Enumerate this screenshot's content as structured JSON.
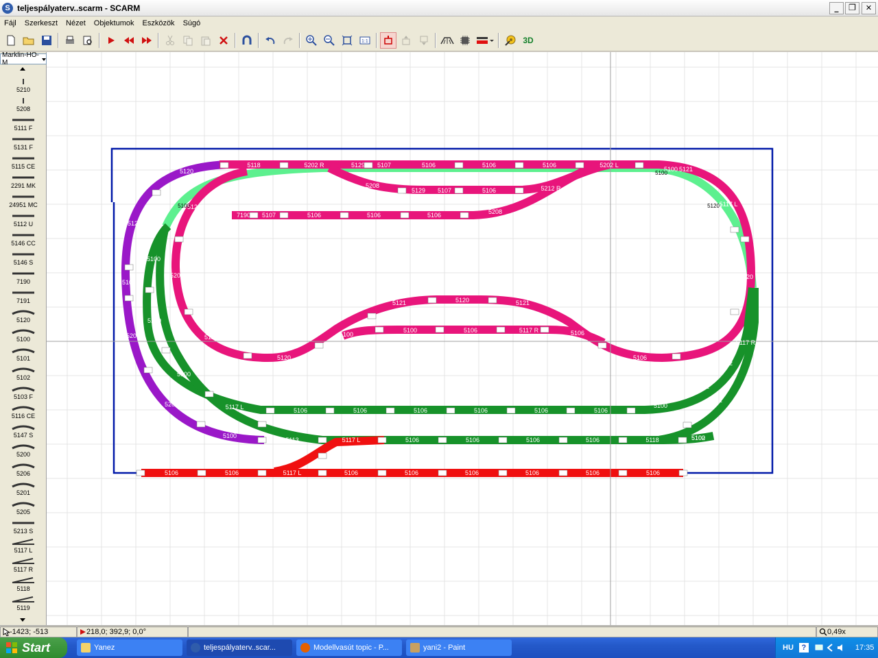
{
  "window": {
    "title": "teljespályaterv..scarm - SCARM",
    "app_icon": "S",
    "minimize_label": "_",
    "restore_label": "❐",
    "close_label": "✕"
  },
  "menu": [
    "Fájl",
    "Szerkeszt",
    "Nézet",
    "Objektumok",
    "Eszközök",
    "Súgó"
  ],
  "toolbar": {
    "buttons": [
      {
        "icon": "new-file-icon",
        "enabled": true
      },
      {
        "icon": "open-folder-icon",
        "enabled": true
      },
      {
        "icon": "save-icon",
        "enabled": true
      },
      {
        "icon": "print-icon",
        "enabled": true
      },
      {
        "icon": "print-preview-icon",
        "enabled": true
      },
      {
        "icon": "play-icon",
        "enabled": true
      },
      {
        "icon": "rewind-icon",
        "enabled": true
      },
      {
        "icon": "forward-icon",
        "enabled": true
      },
      {
        "icon": "cut-icon",
        "enabled": false
      },
      {
        "icon": "copy-icon",
        "enabled": false
      },
      {
        "icon": "paste-icon",
        "enabled": false
      },
      {
        "icon": "delete-icon",
        "enabled": true
      },
      {
        "icon": "magnet-icon",
        "enabled": true
      },
      {
        "icon": "undo-icon",
        "enabled": true
      },
      {
        "icon": "redo-icon",
        "enabled": false
      },
      {
        "icon": "zoom-in-icon",
        "enabled": true
      },
      {
        "icon": "zoom-out-icon",
        "enabled": true
      },
      {
        "icon": "zoom-fit-icon",
        "enabled": true
      },
      {
        "icon": "zoom-1to1-icon",
        "enabled": true
      },
      {
        "icon": "layer-icon",
        "enabled": true
      },
      {
        "icon": "layer-up-icon",
        "enabled": false
      },
      {
        "icon": "layer-down-icon",
        "enabled": false
      },
      {
        "icon": "bridge-icon",
        "enabled": true
      },
      {
        "icon": "chip-icon",
        "enabled": true
      },
      {
        "icon": "line-color-icon",
        "enabled": true
      },
      {
        "icon": "measure-icon",
        "enabled": true
      },
      {
        "icon": "3d-view-icon",
        "label": "3D",
        "enabled": true
      }
    ]
  },
  "library": {
    "selected": "Marklin-HO-M",
    "items": [
      "5210",
      "5208",
      "5111 F",
      "5131 F",
      "5115 CE",
      "2291 MK",
      "24951 MC",
      "5112 U",
      "5146 CC",
      "5146 S",
      "7190",
      "7191",
      "5120",
      "5100",
      "5101",
      "5102",
      "5103 F",
      "5116 CE",
      "5147 S",
      "5200",
      "5206",
      "5201",
      "5205",
      "5213 S",
      "5117 L",
      "5117 R",
      "5118",
      "5119"
    ]
  },
  "colors": {
    "magenta": "#e8157b",
    "purple": "#9a18c8",
    "dark_green": "#17922a",
    "light_green": "#5df08f",
    "red": "#f01010",
    "board": "#0018a8"
  },
  "track_labels": {
    "magenta": [
      "5120",
      "5118",
      "5202 R",
      "5129",
      "5107",
      "5106",
      "5106",
      "5106",
      "5202 L",
      "5100",
      "5208",
      "5129",
      "5107",
      "5106",
      "5212 R",
      "5208",
      "5121",
      "7190",
      "5107",
      "5106",
      "5106",
      "5106",
      "5206",
      "5120",
      "5120",
      "5121",
      "5120",
      "5121",
      "5100",
      "5106",
      "5100",
      "5117 R",
      "5106",
      "5106",
      "5107",
      "5117 L",
      "5120",
      "5121",
      "5120"
    ],
    "purple": [
      "5120",
      "5107",
      "5200",
      "5200",
      "5100"
    ],
    "light_green": [
      "5100",
      "5100",
      "5120"
    ],
    "green": [
      "5100",
      "5100",
      "5100",
      "5117 L",
      "5106",
      "5106",
      "5106",
      "5106",
      "5106",
      "5106",
      "5100",
      "5102",
      "5102",
      "5117 R",
      "5102",
      "5100",
      "5113",
      "5106",
      "5106",
      "5106",
      "5106",
      "5118",
      "5102"
    ],
    "red": [
      "5117 L",
      "5106",
      "5106",
      "5117 L",
      "5106",
      "5106",
      "5106",
      "5106",
      "5106",
      "5106"
    ]
  },
  "status": {
    "cursor": "-1423; -513",
    "position": "218,0; 392,9; 0,0°",
    "zoom": "0,49x"
  },
  "taskbar": {
    "start_label": "Start",
    "tasks": [
      {
        "label": "Yanez",
        "active": false
      },
      {
        "label": "teljespályaterv..scar...",
        "active": true
      },
      {
        "label": "Modellvasút topic - P...",
        "active": false
      },
      {
        "label": "yani2 - Paint",
        "active": false
      }
    ],
    "language": "HU",
    "clock": "17:35"
  }
}
